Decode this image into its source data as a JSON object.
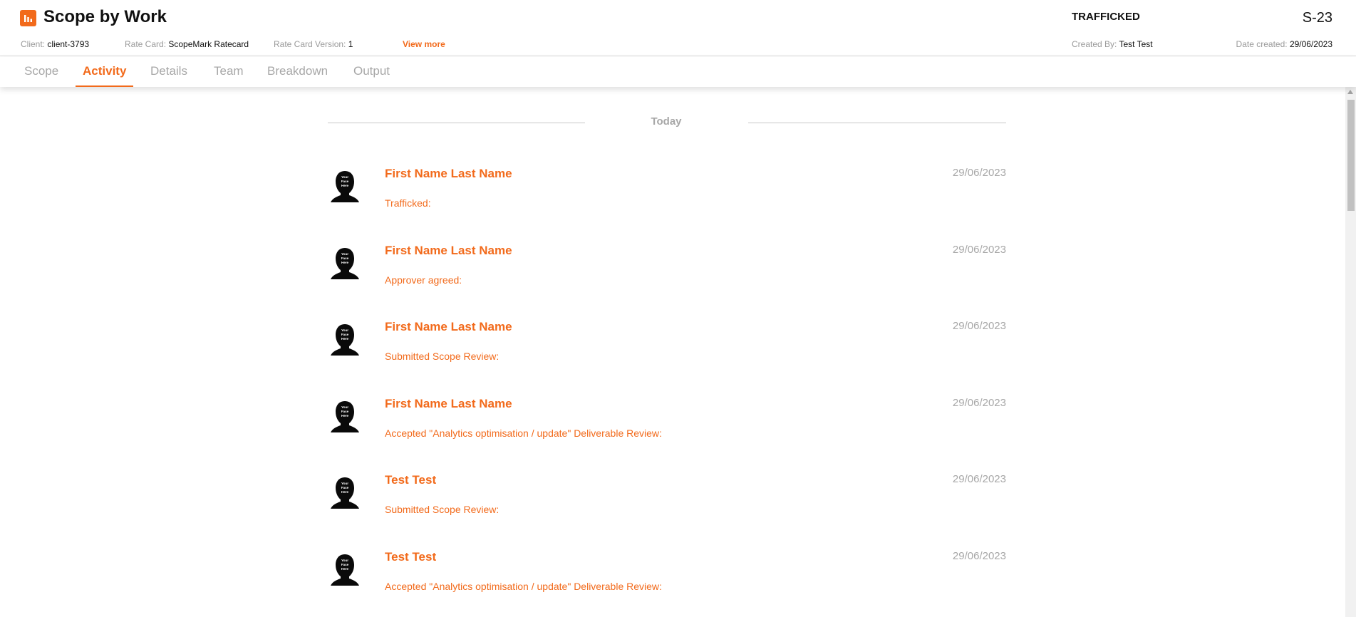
{
  "header": {
    "title": "Scope by Work",
    "logo_icon": "bar-chart-icon",
    "client_key": "Client:",
    "client_value": "client-3793",
    "rate_card_key": "Rate Card:",
    "rate_card_value": "ScopeMark Ratecard",
    "rate_card_version_key": "Rate Card Version:",
    "rate_card_version_value": "1",
    "view_more": "View more",
    "status": "TRAFFICKED",
    "scope_id": "S-23",
    "created_by_key": "Created By:",
    "created_by_value": "Test Test",
    "date_created_key": "Date created:",
    "date_created_value": "29/06/2023"
  },
  "tabs": [
    {
      "label": "Scope"
    },
    {
      "label": "Activity",
      "active": true
    },
    {
      "label": "Details"
    },
    {
      "label": "Team"
    },
    {
      "label": "Breakdown"
    },
    {
      "label": "Output"
    }
  ],
  "activity": {
    "group_label": "Today",
    "avatar_text": [
      "Your",
      "Face",
      "Here"
    ],
    "entries": [
      {
        "name": "First Name Last Name",
        "date": "29/06/2023",
        "message": "Trafficked:"
      },
      {
        "name": "First Name Last Name",
        "date": "29/06/2023",
        "message": "Approver agreed:"
      },
      {
        "name": "First Name Last Name",
        "date": "29/06/2023",
        "message": "Submitted Scope Review:"
      },
      {
        "name": "First Name Last Name",
        "date": "29/06/2023",
        "message": "Accepted \"Analytics optimisation / update\" Deliverable Review:"
      },
      {
        "name": "Test Test",
        "date": "29/06/2023",
        "message": "Submitted Scope Review:"
      },
      {
        "name": "Test Test",
        "date": "29/06/2023",
        "message": "Accepted \"Analytics optimisation / update\" Deliverable Review:"
      }
    ]
  },
  "colors": {
    "accent": "#f26a1b",
    "muted": "#a7a7a7"
  }
}
